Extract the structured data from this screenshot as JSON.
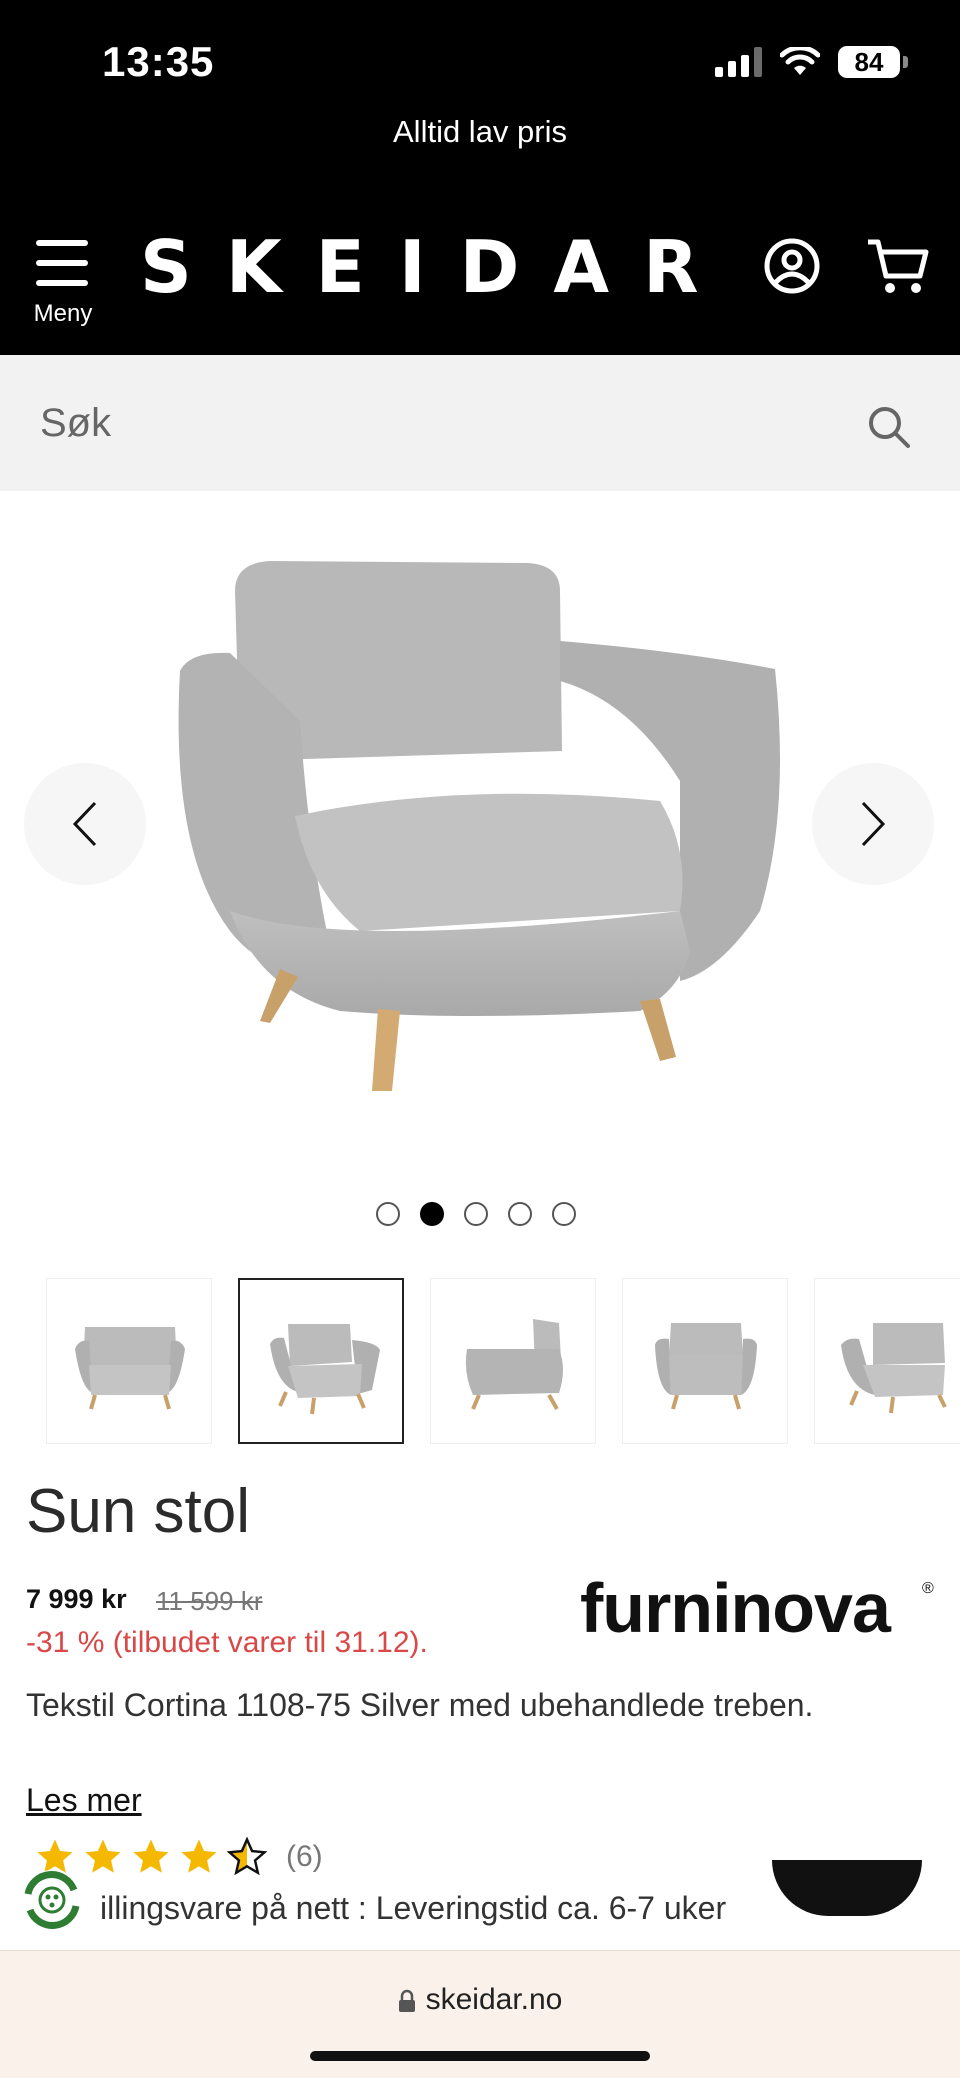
{
  "status_bar": {
    "time": "13:35",
    "battery": "84"
  },
  "header": {
    "tagline": "Alltid lav pris",
    "menu_label": "Meny",
    "logo": "SKEIDAR",
    "icons": [
      "account-icon",
      "cart-icon"
    ]
  },
  "search": {
    "placeholder": "Søk",
    "icon": "search-icon"
  },
  "gallery": {
    "image_count": 5,
    "active_index": 2,
    "thumbnails": 5
  },
  "product": {
    "title": "Sun stol",
    "price": "7 999 kr",
    "old_price": "11 599 kr",
    "discount": "-31 % (tilbudet varer til 31.12).",
    "brand": "furninova",
    "brand_reg": "®",
    "description": "Tekstil Cortina 1108-75 Silver med ubehandlede treben.",
    "read_more": "Les mer",
    "rating_value": 4.5,
    "rating_count": "(6)",
    "delivery": "illingsvare på nett : Leveringstid ca. 6-7 uker"
  },
  "browser": {
    "url": "skeidar.no"
  },
  "colors": {
    "header_bg": "#000000",
    "search_bg": "#f2f2f2",
    "discount": "#d94747",
    "star": "#f5b800",
    "bottom_bar_bg": "#faf1ea"
  }
}
